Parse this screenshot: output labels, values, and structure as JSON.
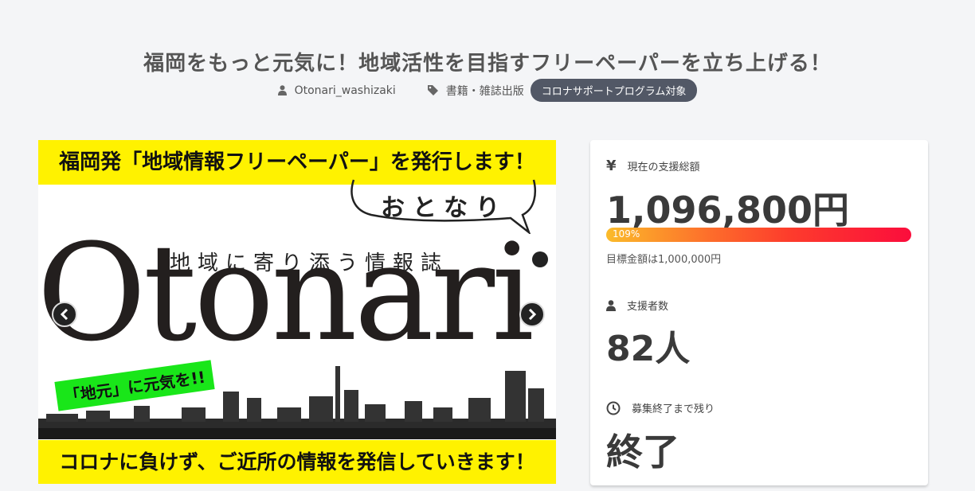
{
  "project": {
    "title": "福岡をもっと元気に！地域活性を目指すフリーペーパーを立ち上げる！",
    "author": "Otonari_washizaki",
    "category": "書籍・雑誌出版",
    "badge": "コロナサポートプログラム対象"
  },
  "slider": {
    "banner_top": "福岡発「地域情報フリーペーパー」を発行します！",
    "bubble_text": "おとなり",
    "subtitle": "地域に寄り添う情報誌",
    "logo": "Otonari",
    "sticker": "「地元」に元気を!!",
    "banner_bottom": "コロナに負けず、ご近所の情報を発信していきます！",
    "icons": {
      "prev": "chevron-left-icon",
      "next": "chevron-right-icon"
    }
  },
  "stats": {
    "funding_label": "現在の支援総額",
    "funding_amount": "1,096,800円",
    "progress_label": "109%",
    "progress_percent": 109,
    "goal_text": "目標金額は1,000,000円",
    "backers_label": "支援者数",
    "backers_value": "82人",
    "remaining_label": "募集終了まで残り",
    "remaining_value": "終了",
    "icons": {
      "funding": "yen-icon",
      "backers": "user-icon",
      "remaining": "clock-icon"
    }
  },
  "colors": {
    "badge_bg": "#525866",
    "banner_yellow": "#fff200",
    "sticker_green": "#19e619",
    "progress_start": "#fbbb2a",
    "progress_end": "#fb0d3c"
  }
}
